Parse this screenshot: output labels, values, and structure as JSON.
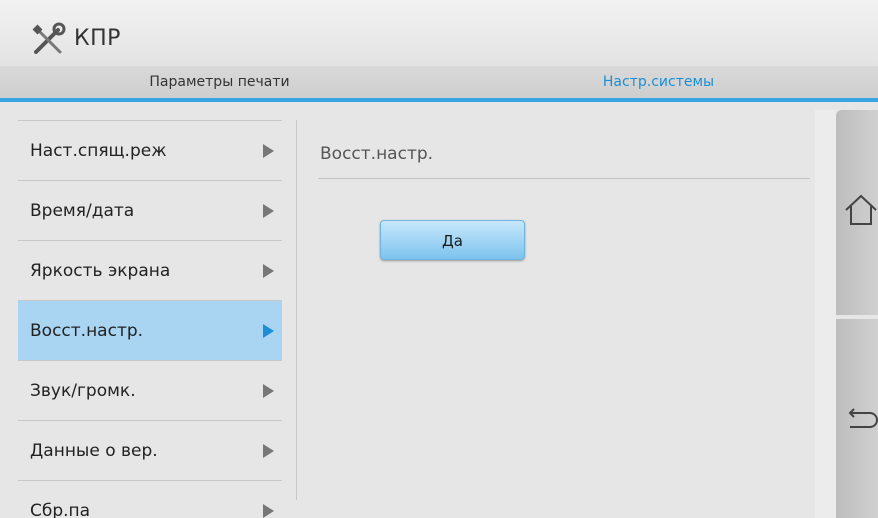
{
  "header": {
    "title": "КПР",
    "logo_icon": "tools-icon"
  },
  "tabs": [
    {
      "label": "Параметры печати",
      "active": false
    },
    {
      "label": "Настр.системы",
      "active": true
    }
  ],
  "accent_color": "#1b8fd6",
  "menu": {
    "items": [
      {
        "label": "Наст.спящ.реж",
        "selected": false
      },
      {
        "label": "Время/дата",
        "selected": false
      },
      {
        "label": "Яркость экрана",
        "selected": false
      },
      {
        "label": "Восст.настр.",
        "selected": true
      },
      {
        "label": "Звук/громк.",
        "selected": false
      },
      {
        "label": "Данные о вер.",
        "selected": false
      },
      {
        "label": "Сбр.па",
        "selected": false
      }
    ]
  },
  "content": {
    "title": "Восст.настр.",
    "confirm_button": "Да"
  },
  "rail": {
    "home_icon": "home-icon",
    "back_icon": "back-icon"
  }
}
